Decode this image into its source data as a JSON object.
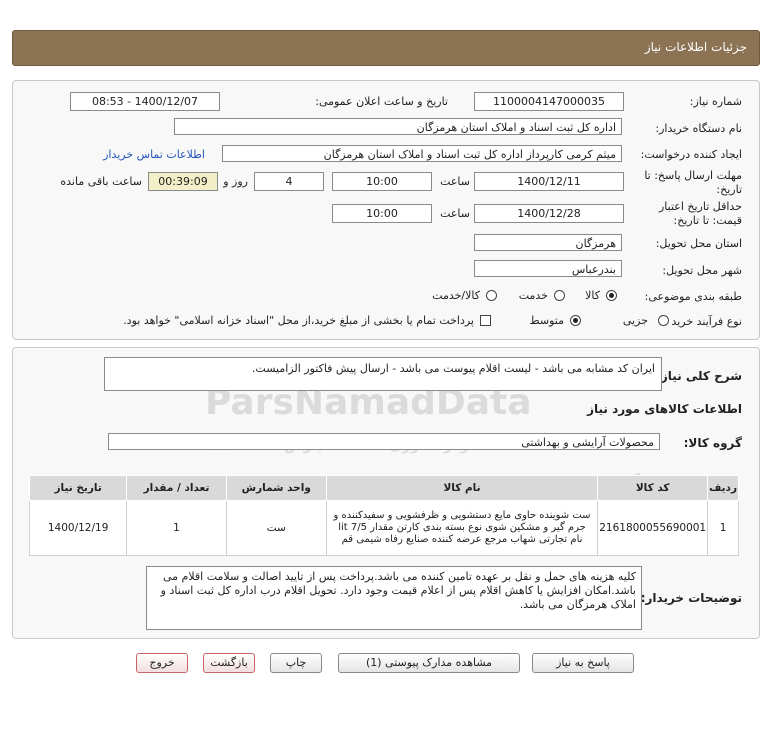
{
  "header": {
    "title": "جزئیات اطلاعات نیاز"
  },
  "fields": {
    "need_number_label": "شماره نیاز:",
    "need_number": "1100004147000035",
    "announce_label": "تاریخ و ساعت اعلان عمومی:",
    "announce_value": "1400/12/07 - 08:53",
    "buyer_org_label": "نام دستگاه خریدار:",
    "buyer_org": "اداره کل ثبت اسناد و املاک استان هرمزگان",
    "creator_label": "ایجاد کننده درخواست:",
    "creator": "میثم کرمی کارپرداز اداره کل ثبت اسناد و املاک استان هرمزگان",
    "contact_link": "اطلاعات تماس خریدار",
    "reply_deadline_label": "مهلت ارسال پاسخ: تا تاریخ:",
    "reply_date": "1400/12/11",
    "time_label": "ساعت",
    "reply_time": "10:00",
    "days_value": "4",
    "days_label": "روز و",
    "remaining_value": "00:39:09",
    "remaining_label": "ساعت باقی مانده",
    "validity_label": "حداقل تاریخ اعتبار قیمت: تا تاریخ:",
    "validity_date": "1400/12/28",
    "validity_time_label": "ساعت",
    "validity_time": "10:00",
    "province_label": "استان محل تحویل:",
    "province": "هرمزگان",
    "city_label": "شهر محل تحویل:",
    "city": "بندرعباس",
    "category_label": "طبقه بندی موضوعی:",
    "category_options": [
      "کالا",
      "خدمت",
      "کالا/خدمت"
    ],
    "process_label": "نوع فرآیند خرید :",
    "process_options": [
      "جزیی",
      "متوسط"
    ],
    "payment_note": "پرداخت تمام یا بخشی از مبلغ خرید،از محل \"اسناد خزانه اسلامی\" خواهد بود."
  },
  "description": {
    "label": "شرح کلی نیاز:",
    "text": "ایران کد مشابه می باشد - لیست اقلام پیوست می باشد - ارسال پیش فاکتور الزامیست."
  },
  "goods": {
    "section_title": "اطلاعات کالاهای مورد نیاز",
    "group_label": "گروه کالا:",
    "group_value": "محصولات آرایشی و بهداشتی",
    "columns": [
      "ردیف",
      "کد کالا",
      "نام کالا",
      "واحد شمارش",
      "تعداد / مقدار",
      "تاریخ نیاز"
    ],
    "rows": [
      {
        "row": "1",
        "code": "2161800055690001",
        "name": "ست شوینده حاوی مایع دستشویی و ظرفشویی و سفیدکننده و جرم گیر و مشکین شوی نوع بسته بندی کارتن مقدار 7/5 lit نام تجارتی شهاب مرجع عرضه کننده صنایع رفاه شیمی قم",
        "unit": "ست",
        "qty": "1",
        "date": "1400/12/19"
      }
    ]
  },
  "buyer_notes": {
    "label": "توضیحات خریدار:",
    "text": "کلیه هزینه های حمل و نقل بر عهده تامین کننده می باشد.پرداخت پس از تایید اصالت و سلامت اقلام می باشد.امکان افزایش یا کاهش اقلام پس از اعلام قیمت وجود دارد. تحویل اقلام درب اداره کل ثبت اسناد و املاک هرمزگان می باشد."
  },
  "buttons": {
    "reply": "پاسخ به نیاز",
    "view_docs": "مشاهده مدارک پیوستی (1)",
    "print": "چاپ",
    "back": "بازگشت",
    "exit": "خروج"
  },
  "watermark": {
    "brand": "ParsNamadData",
    "line1": "پایگاه اطلاع رسانی مناقصات و مزایده",
    "line2": "مرکز فناوری اطلاعات پارس نماد داده ها"
  }
}
